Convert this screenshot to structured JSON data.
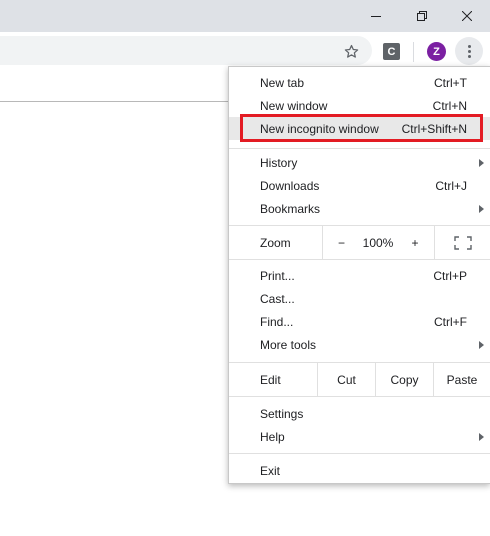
{
  "window": {
    "minimize_icon": "minimize-icon",
    "restore_icon": "restore-icon",
    "close_icon": "close-icon"
  },
  "toolbar": {
    "bookmark_icon": "star-icon",
    "extension_label": "C",
    "profile_initial": "Z",
    "profile_color": "#7b1fa2",
    "menu_icon": "vertical-dots-icon"
  },
  "menu": {
    "new_tab": {
      "label": "New tab",
      "shortcut": "Ctrl+T"
    },
    "new_window": {
      "label": "New window",
      "shortcut": "Ctrl+N"
    },
    "new_incognito": {
      "label": "New incognito window",
      "shortcut": "Ctrl+Shift+N"
    },
    "history": {
      "label": "History"
    },
    "downloads": {
      "label": "Downloads",
      "shortcut": "Ctrl+J"
    },
    "bookmarks": {
      "label": "Bookmarks"
    },
    "zoom": {
      "label": "Zoom",
      "minus": "−",
      "value": "100%",
      "plus": "+"
    },
    "print": {
      "label": "Print...",
      "shortcut": "Ctrl+P"
    },
    "cast": {
      "label": "Cast..."
    },
    "find": {
      "label": "Find...",
      "shortcut": "Ctrl+F"
    },
    "more_tools": {
      "label": "More tools"
    },
    "edit": {
      "label": "Edit",
      "cut": "Cut",
      "copy": "Copy",
      "paste": "Paste"
    },
    "settings": {
      "label": "Settings"
    },
    "help": {
      "label": "Help"
    },
    "exit": {
      "label": "Exit"
    }
  },
  "colors": {
    "highlight_border": "#e31b23",
    "titlebar": "#dee1e6"
  }
}
